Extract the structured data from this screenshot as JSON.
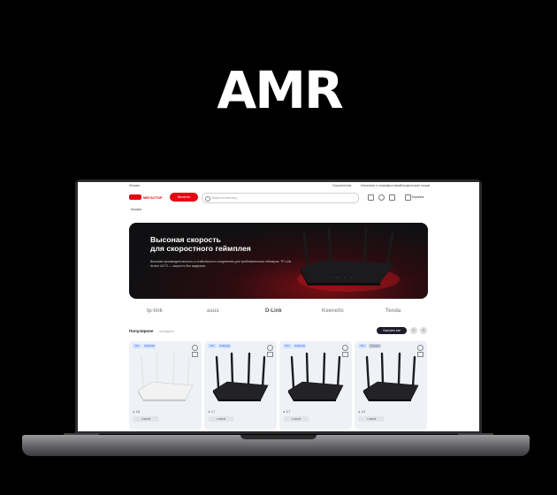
{
  "logo": {
    "text": "AMR"
  },
  "topbar": {
    "left": "Москва",
    "links": [
      "Покупателям",
      "Магазины и сервис",
      "Доставка",
      "Юридическим лицам"
    ]
  },
  "header": {
    "brand": "МЕГАСТОР",
    "catalog_button": "Каталог",
    "search_placeholder": "Поиск по каталогу",
    "cart_label": "Корзина"
  },
  "city_selector": "Москва",
  "banner": {
    "title_line1": "Высоная скорость",
    "title_line2": "для скоростного геймплея",
    "body": "Высокая производительность и стабильность соединения для требовательных геймеров. TP-Link Archer AX73 — скорость без задержек."
  },
  "brands": [
    "tp-link",
    "asus",
    "D-Link",
    "Keenetic",
    "Tenda"
  ],
  "popular": {
    "title": "Популярное",
    "subtitle": "за неделю",
    "show_all": "Смотреть все",
    "prev": "‹",
    "next": "›"
  },
  "products": [
    {
      "badge1": "Хит",
      "badge2": "Новинка",
      "color": "white",
      "rating": "★ 4.8",
      "price": "3 990 ₽"
    },
    {
      "badge1": "Хит",
      "badge2": "Новинка",
      "color": "black",
      "rating": "★ 4.7",
      "price": "4 490 ₽"
    },
    {
      "badge1": "Хит",
      "badge2": "Новинка",
      "color": "black",
      "rating": "★ 4.7",
      "price": "4 490 ₽"
    },
    {
      "badge1": "Хит",
      "badge2": "Скидка",
      "color": "black",
      "rating": "★ 4.9",
      "price": "7 990 ₽"
    }
  ],
  "colors": {
    "accent": "#e30613",
    "dark": "#1c1c2a"
  }
}
